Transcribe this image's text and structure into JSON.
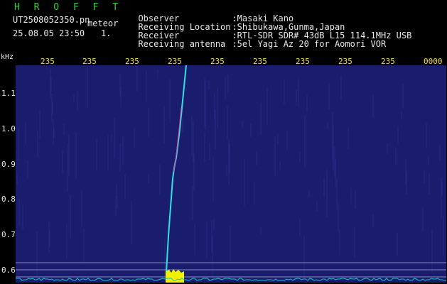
{
  "header": {
    "app_title": "H R O F F T",
    "file_name": "UT2508052350.pn",
    "mode_label": "meteor",
    "datetime": "25.08.05 23:50",
    "counter": "1.",
    "info": [
      {
        "label": "Observer",
        "value": ":Masaki Kano"
      },
      {
        "label": "Receiving Location",
        "value": ":Shibukawa,Gunma,Japan"
      },
      {
        "label": "Receiver",
        "value": ":RTL-SDR SDR# 43dB L15 114.1MHz USB"
      },
      {
        "label": "Receiving antenna",
        "value": ":5el Yagi Az 20 for Aomori VOR"
      }
    ]
  },
  "axes": {
    "y_unit": "kHz",
    "y_ticks": [
      "1.1",
      "1.0",
      "0.9",
      "0.8",
      "0.7",
      "0.6"
    ],
    "time_ticks": [
      "235",
      "235",
      "235",
      "235",
      "235",
      "235",
      "235",
      "235",
      "235",
      "0000"
    ]
  },
  "colors": {
    "background": "#1a1d6e",
    "trace": "#30e0e0",
    "trace_hot": "#e040a0",
    "burst": "#f0f000",
    "baseline": "#20c0c0",
    "tick_text": "#f0e040"
  }
}
